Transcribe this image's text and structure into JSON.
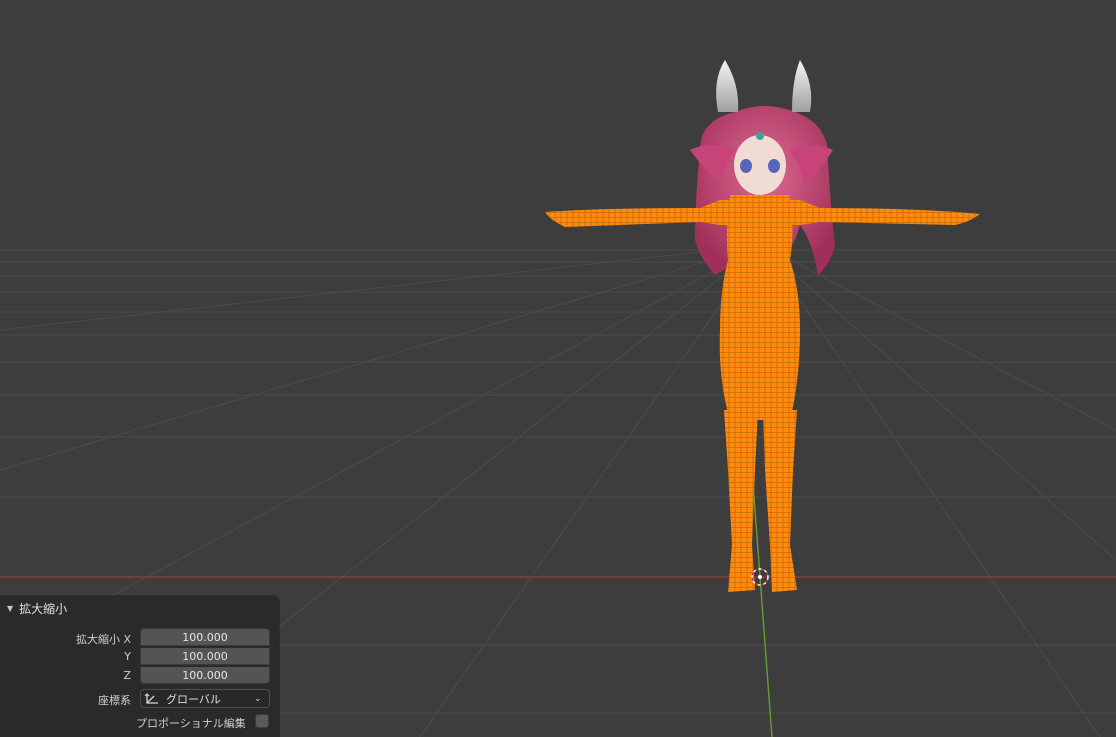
{
  "colors": {
    "background": "#3d3d3d",
    "grid": "#4a4a4a",
    "x_axis": "#9a3b3b",
    "y_axis": "#6b9b2f",
    "selection": "#ff8a10",
    "panel_bg": "#2a2a2a",
    "field_bg": "#545454"
  },
  "redo_panel": {
    "title": "拡大縮小",
    "scale_x_label": "拡大縮小 X",
    "scale_y_label": "Y",
    "scale_z_label": "Z",
    "scale_x": "100.000",
    "scale_y": "100.000",
    "scale_z": "100.000",
    "orientation_label": "座標系",
    "orientation_value": "グローバル",
    "proportional_label": "プロポーショナル編集",
    "proportional_checked": false
  }
}
